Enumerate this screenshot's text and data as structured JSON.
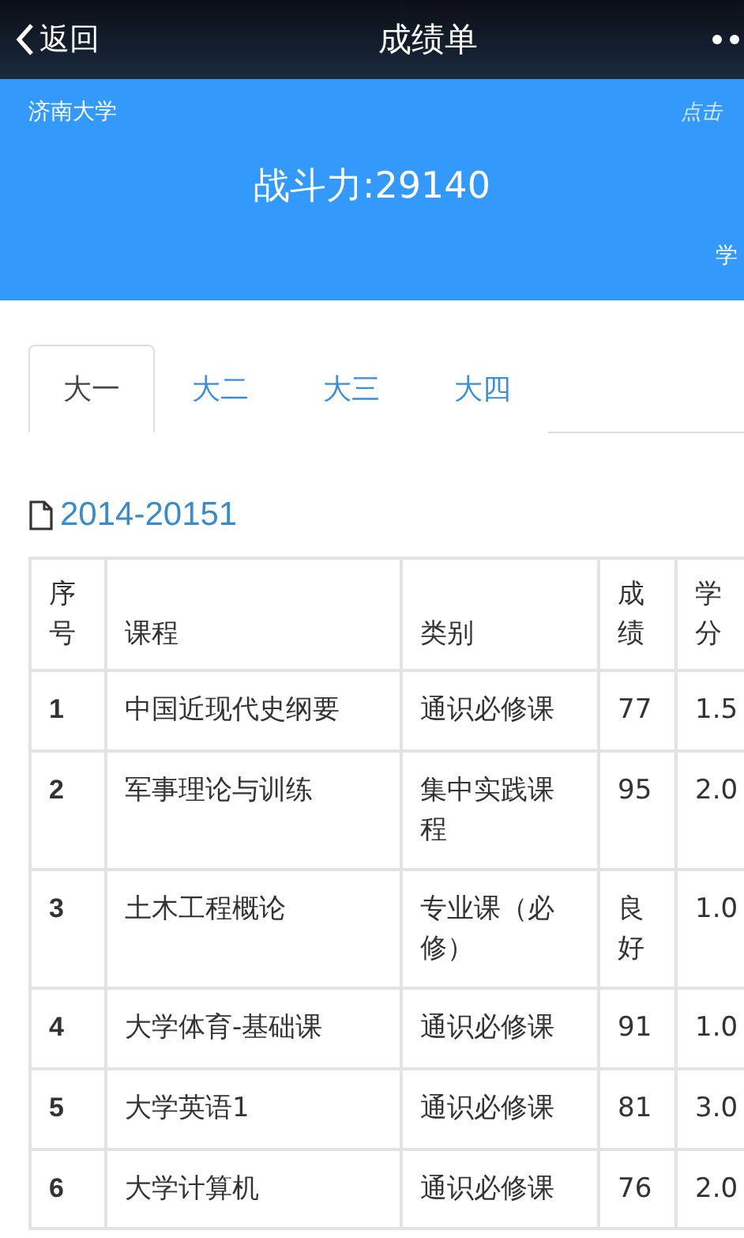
{
  "nav": {
    "back": "返回",
    "title": "成绩单"
  },
  "banner": {
    "school": "济南大学",
    "hint": "点击",
    "score": "战斗力:29140",
    "corner": "学"
  },
  "tabs": [
    {
      "label": "大一",
      "selected": true
    },
    {
      "label": "大二",
      "selected": false
    },
    {
      "label": "大三",
      "selected": false
    },
    {
      "label": "大四",
      "selected": false
    }
  ],
  "term": "2014-20151",
  "table": {
    "columns": [
      "序号",
      "课程",
      "类别",
      "成绩",
      "学分"
    ],
    "rows": [
      [
        "1",
        "中国近现代史纲要",
        "通识必修课",
        "77",
        "1.5"
      ],
      [
        "2",
        "军事理论与训练",
        "集中实践课程",
        "95",
        "2.0"
      ],
      [
        "3",
        "土木工程概论",
        "专业课（必修）",
        "良好",
        "1.0"
      ],
      [
        "4",
        "大学体育-基础课",
        "通识必修课",
        "91",
        "1.0"
      ],
      [
        "5",
        "大学英语1",
        "通识必修课",
        "81",
        "3.0"
      ],
      [
        "6",
        "大学计算机",
        "通识必修课",
        "76",
        "2.0"
      ]
    ]
  }
}
